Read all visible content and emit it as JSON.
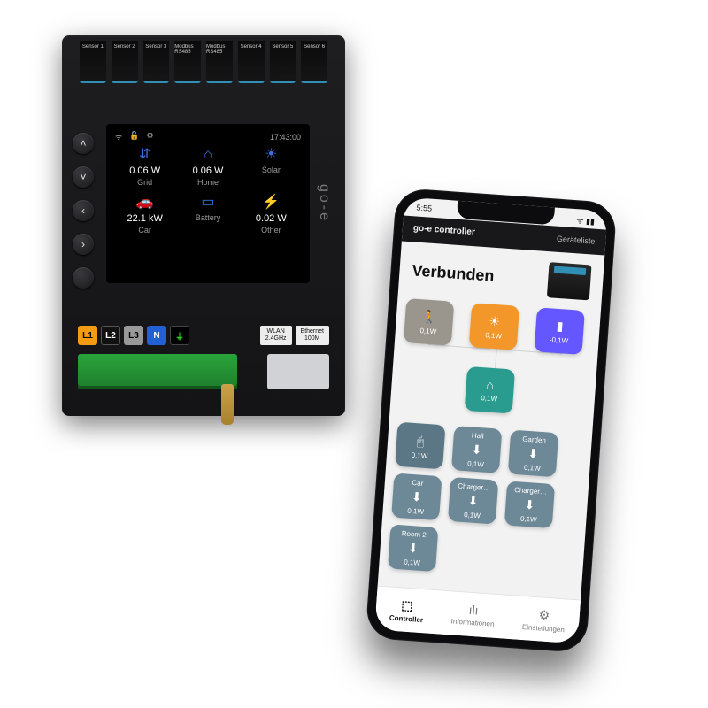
{
  "device": {
    "terminals": [
      "Sensor 1",
      "Sensor 2",
      "Sensor 3",
      "Modbus RS485",
      "Modbus RS485",
      "Sensor 4",
      "Sensor 5",
      "Sensor 6"
    ],
    "clock": "17:43:00",
    "brand": "go-e",
    "metrics": [
      {
        "icon": "⇵",
        "value": "0.06 W",
        "label": "Grid"
      },
      {
        "icon": "⌂",
        "value": "0.06 W",
        "label": "Home"
      },
      {
        "icon": "☀",
        "value": "",
        "label": "Solar"
      },
      {
        "icon": "🚗",
        "value": "22.1 kW",
        "label": "Car"
      },
      {
        "icon": "▭",
        "value": "",
        "label": "Battery"
      },
      {
        "icon": "⚡",
        "value": "0.02 W",
        "label": "Other"
      }
    ],
    "phases": {
      "l1": "L1",
      "l2": "L2",
      "l3": "L3",
      "n": "N",
      "ground": "⏚"
    },
    "wlan": "WLAN\n2.4GHz",
    "eth": "Ethernet\n100M"
  },
  "phone": {
    "status_time": "5:55",
    "app_title": "go-e controller",
    "device_list": "Geräteliste ",
    "hero": "Verbunden",
    "top_nodes": [
      {
        "cls": "n-grey",
        "icon": "🚶",
        "val": "0,1W"
      },
      {
        "cls": "n-orange",
        "icon": "☀",
        "val": "0,1W"
      },
      {
        "cls": "n-purple",
        "icon": "▮",
        "val": "-0,1W"
      }
    ],
    "home_node": {
      "cls": "n-teal",
      "icon": "⌂",
      "val": "0,1W"
    },
    "rooms": [
      {
        "label": "",
        "icon": "🖰",
        "val": "0,1W"
      },
      {
        "label": "Hall",
        "icon": "⬇",
        "val": "0,1W"
      },
      {
        "label": "Garden",
        "icon": "⬇",
        "val": "0,1W"
      },
      {
        "label": "Car",
        "icon": "⬇",
        "val": "0,1W"
      },
      {
        "label": "Charger…",
        "icon": "⬇",
        "val": "0,1W"
      },
      {
        "label": "Charger…",
        "icon": "⬇",
        "val": "0,1W"
      },
      {
        "label": "Room 2",
        "icon": "⬇",
        "val": "0,1W"
      }
    ],
    "tabs": [
      {
        "icon": "⬚",
        "label": "Controller",
        "active": true
      },
      {
        "icon": "ılı",
        "label": "Informationen",
        "active": false
      },
      {
        "icon": "⚙",
        "label": "Einstellungen",
        "active": false
      }
    ]
  }
}
